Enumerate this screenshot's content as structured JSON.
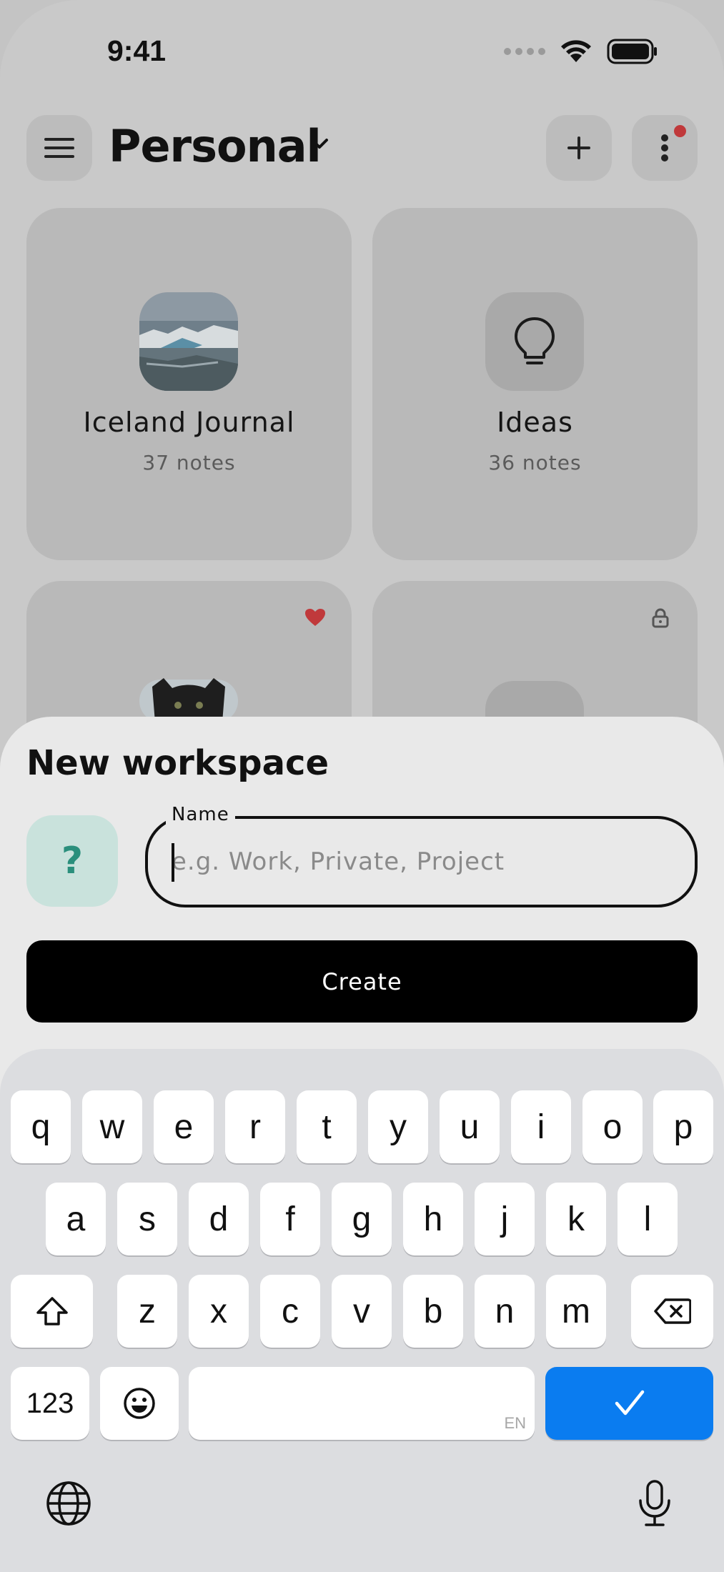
{
  "status": {
    "time": "9:41"
  },
  "header": {
    "workspace_name": "Personal"
  },
  "cards": [
    {
      "name": "Iceland Journal",
      "count": "37 notes"
    },
    {
      "name": "Ideas",
      "count": "36 notes"
    }
  ],
  "sheet": {
    "title": "New workspace",
    "emoji_placeholder": "?",
    "field_label": "Name",
    "field_placeholder": "e.g. Work, Private, Project",
    "create_label": "Create"
  },
  "keyboard": {
    "row1": [
      "q",
      "w",
      "e",
      "r",
      "t",
      "y",
      "u",
      "i",
      "o",
      "p"
    ],
    "row2": [
      "a",
      "s",
      "d",
      "f",
      "g",
      "h",
      "j",
      "k",
      "l"
    ],
    "row3": [
      "z",
      "x",
      "c",
      "v",
      "b",
      "n",
      "m"
    ],
    "numbers_label": "123",
    "space_hint": "EN"
  },
  "colors": {
    "accent_blue": "#0a7cf0",
    "notification_red": "#c0393b",
    "emoji_bg": "#c9e2dc",
    "emoji_fg": "#2a8f7c"
  },
  "icons": {
    "menu": "hamburger-icon",
    "dropdown": "chevron-down-icon",
    "add": "plus-icon",
    "more": "more-vertical-icon",
    "idea": "lightbulb-icon",
    "favorite": "heart-icon",
    "locked": "lock-icon",
    "shift": "shift-icon",
    "backspace": "backspace-icon",
    "emoji": "emoji-icon",
    "done": "checkmark-icon",
    "language": "globe-icon",
    "dictation": "microphone-icon"
  }
}
